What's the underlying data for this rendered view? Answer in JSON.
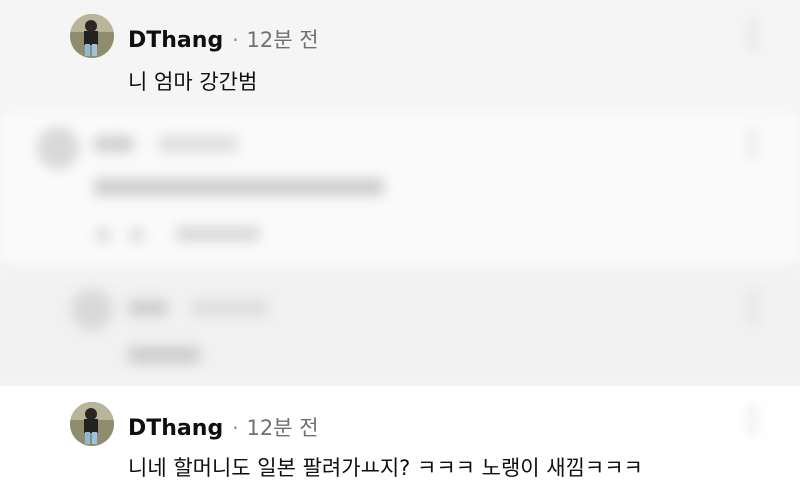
{
  "comments": [
    {
      "author": "DThang",
      "dot": "·",
      "time": "12분 전",
      "text": "니 엄마 강간범"
    },
    {
      "author": "DThang",
      "dot": "·",
      "time": "12분 전",
      "text": "니네 할머니도 일본 팔려가ㅛ지? ㅋㅋㅋ 노랭이 새낌ㅋㅋㅋ"
    }
  ],
  "colors": {
    "background": "#f5f5f5",
    "author": "#0f0f0f",
    "meta": "#707070"
  },
  "icons": [
    "more-vert-icon",
    "avatar"
  ]
}
